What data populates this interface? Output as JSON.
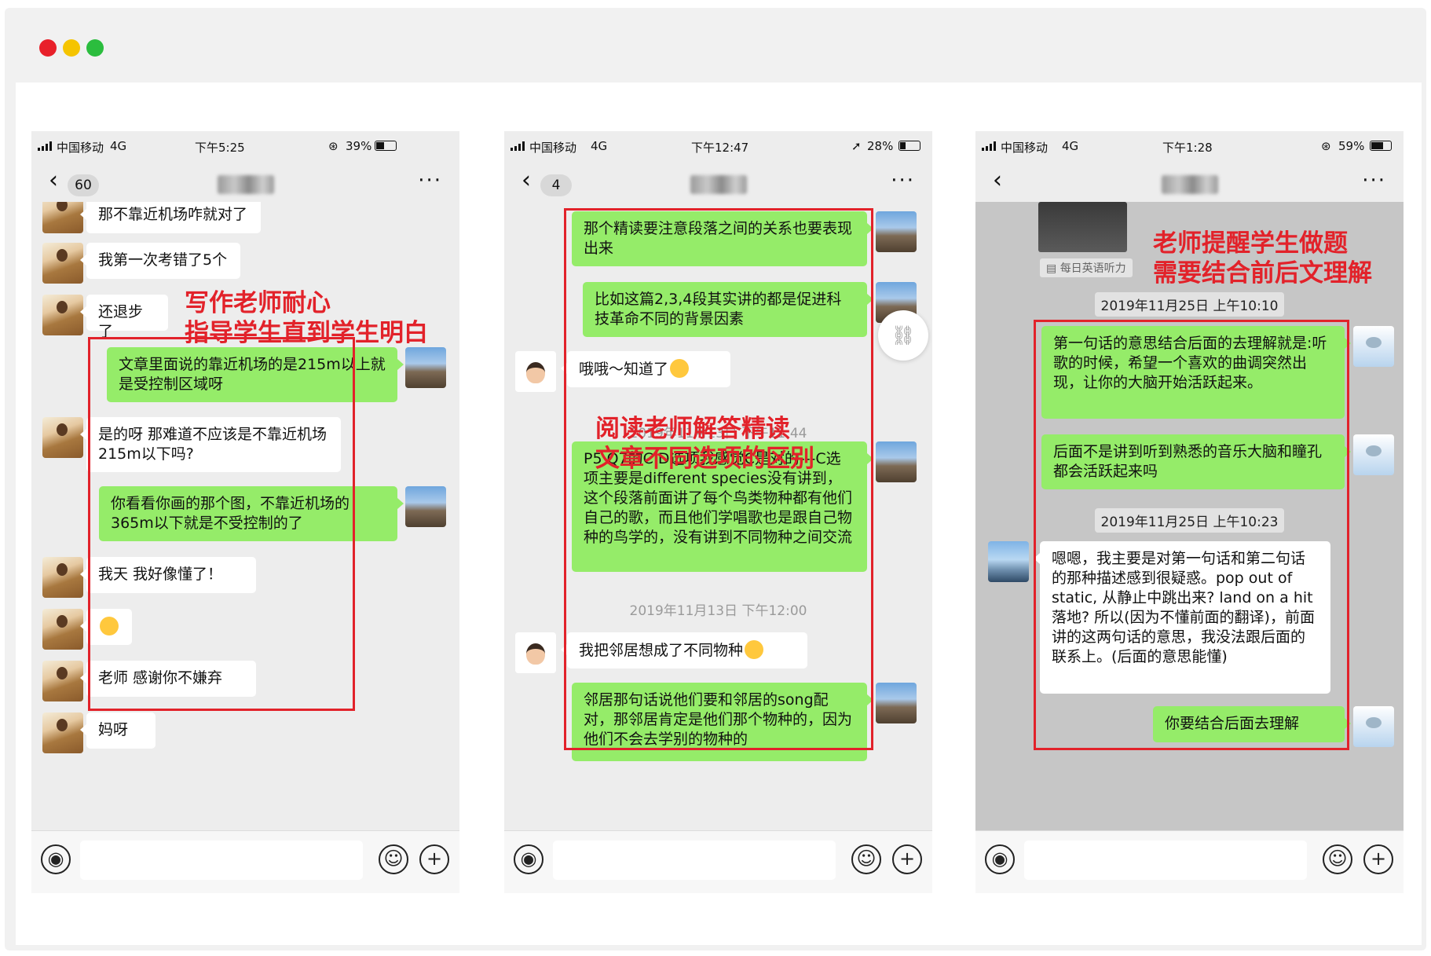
{
  "window": {
    "dots": [
      "#e8202a",
      "#f5c400",
      "#2bbd3e"
    ]
  },
  "phones": [
    {
      "status": {
        "carrier": "中国移动",
        "network": "4G",
        "time": "下午5:25",
        "battery": "39%"
      },
      "unread": "60",
      "messages": [
        "那不靠近机场咋就对了",
        "我第一次考错了5个",
        "还退步了",
        "文章里面说的靠近机场的是215m以上就是受控制区域呀",
        "是的呀 那难道不应该是不靠近机场215m以下吗?",
        "你看看你画的那个图，不靠近机场的365m以下就是不受控制的了",
        "我天 我好像懂了！",
        "老师 感谢你不嫌弃",
        "妈呀"
      ],
      "annotation": [
        "写作老师耐心",
        "指导学生直到学生明白"
      ]
    },
    {
      "status": {
        "carrier": "中国移动",
        "network": "4G",
        "time": "下午12:47",
        "battery": "28%"
      },
      "unread": "4",
      "messages": [
        "那个精读要注意段落之间的关系也要表现出来",
        "比如这篇2,3,4段其实讲的都是促进科技革命不同的背景因素",
        "哦哦～知道了",
        "P5 Q7的C D选项我感觉C是对的---C选项主要是different species没有讲到，这个段落前面讲了每个鸟类物种都有他们自己的歌，而且他们学唱歌也是跟自己物种的鸟学的，没有讲到不同物种之间交流",
        "我把邻居想成了不同物种",
        "邻居那句话说他们要和邻居的song配对，那邻居肯定是他们那个物种的，因为他们不会去学别的物种的"
      ],
      "timestamps": [
        "2019年11月13日 下午11:44",
        "2019年11月13日 下午12:00"
      ],
      "annotation": [
        "阅读老师解答精读",
        "文章不同选项的区别"
      ]
    },
    {
      "status": {
        "carrier": "中国移动",
        "network": "4G",
        "time": "下午1:28",
        "battery": "59%"
      },
      "card_label": "每日英语听力",
      "timestamps": [
        "2019年11月25日 上午10:10",
        "2019年11月25日 上午10:23"
      ],
      "messages": [
        "第一句话的意思结合后面的去理解就是:听歌的时候，希望一个喜欢的曲调突然出现，让你的大脑开始活跃起来。",
        "后面不是讲到听到熟悉的音乐大脑和瞳孔都会活跃起来吗",
        "嗯嗯，我主要是对第一句话和第二句话的那种描述感到很疑惑。pop out of static, 从静止中跳出来? land on a hit 落地? 所以(因为不懂前面的翻译)，前面讲的这两句话的意思，我没法跟后面的联系上。(后面的意思能懂)",
        "你要结合后面去理解"
      ],
      "annotation": [
        "老师提醒学生做题",
        "需要结合前后文理解"
      ]
    }
  ]
}
